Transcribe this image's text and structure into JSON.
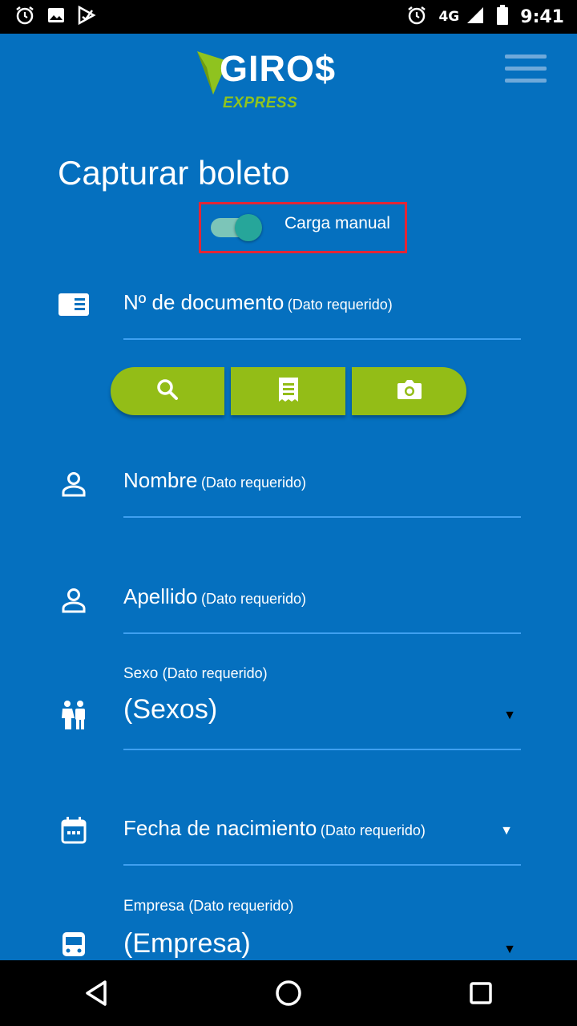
{
  "status_bar": {
    "network": "4G",
    "time": "9:41"
  },
  "header": {
    "logo_text": "GIRO$",
    "logo_subtext": "EXPRESS"
  },
  "page": {
    "title": "Capturar boleto"
  },
  "manual_toggle": {
    "label": "Carga manual",
    "checked": true
  },
  "fields": {
    "document": {
      "label": "Nº de documento",
      "required": "(Dato requerido)"
    },
    "nombre": {
      "label": "Nombre",
      "required": "(Dato requerido)"
    },
    "apellido": {
      "label": "Apellido",
      "required": "(Dato requerido)"
    },
    "sexo": {
      "top_label": "Sexo",
      "required": "(Dato requerido)",
      "value": "(Sexos)"
    },
    "fecha": {
      "label": "Fecha de nacimiento",
      "required": "(Dato requerido)"
    },
    "empresa": {
      "top_label": "Empresa",
      "required": "(Dato requerido)",
      "value": "(Empresa)"
    }
  },
  "actions": [
    "search-icon",
    "receipt-icon",
    "camera-icon"
  ],
  "colors": {
    "background": "#0570BF",
    "accent_green": "#93BD17",
    "highlight_red": "#E32636",
    "underline": "#3FA0F0"
  }
}
